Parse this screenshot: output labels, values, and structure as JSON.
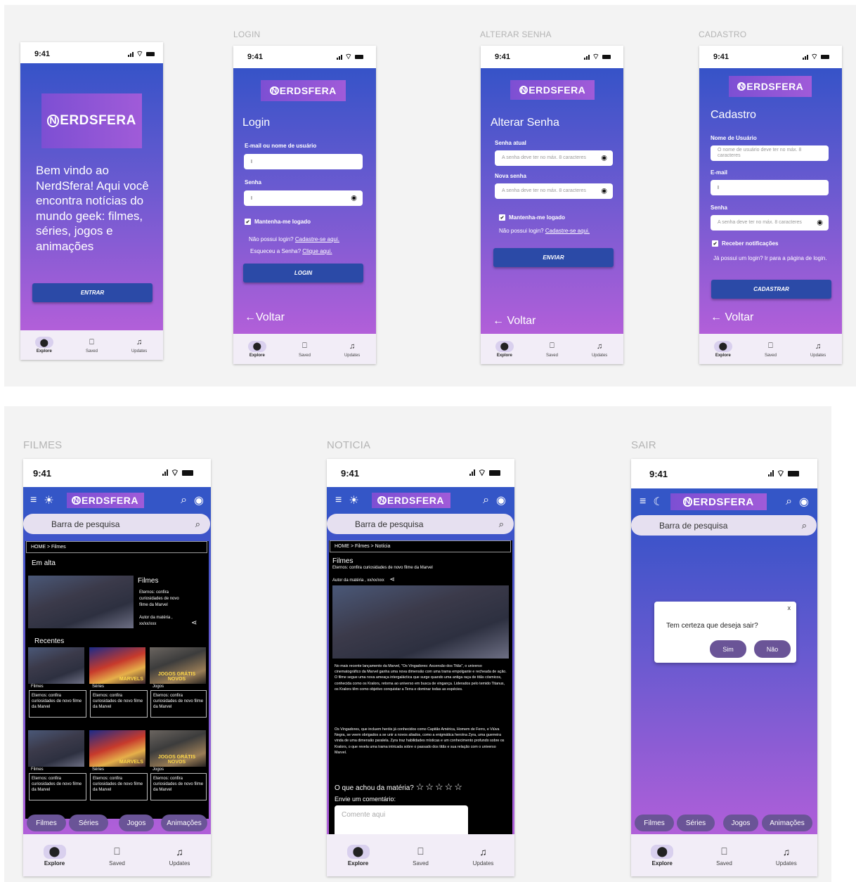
{
  "common": {
    "time": "9:41",
    "nav": {
      "explore": "Explore",
      "saved": "Saved",
      "updates": "Updates"
    },
    "logo_rest": "ERDSFERA",
    "logo_n": "N",
    "search_placeholder": "Barra de pesquisa",
    "back": "Voltar",
    "categories": [
      "Filmes",
      "Séries",
      "Jogos",
      "Animações"
    ]
  },
  "frames": {
    "login": "LOGIN",
    "alterar": "ALTERAR SENHA",
    "cadastro": "CADASTRO",
    "filmes": "FILMES",
    "noticia": "NOTICIA",
    "sair": "SAIR"
  },
  "welcome": {
    "text": "Bem vindo ao NerdSfera! Aqui você encontra notícias do mundo geek:  filmes, séries, jogos e animações",
    "button": "ENTRAR"
  },
  "login": {
    "title": "Login",
    "email_label": "E-mail  ou nome de usuário",
    "email_value": "I",
    "senha_label": "Senha",
    "senha_value": "I",
    "keep": "Mantenha-me logado",
    "no_login": "Não possui login?",
    "signup_link": "Cadastre-se aqui.",
    "forgot": "Esqueceu a Senha?",
    "forgot_link": "Clique aqui.",
    "button": "LOGIN"
  },
  "alterar": {
    "title": "Alterar Senha",
    "atual_label": "Senha atual",
    "atual_ph": "A senha deve ter no máx. 8 caracteres",
    "nova_label": "Nova senha",
    "nova_ph": "A senha deve ter no máx. 8 caracteres",
    "keep": "Mantenha-me logado",
    "no_login": "Não possui login?",
    "signup_link": "Cadastre-se aqui.",
    "button": "ENVIAR"
  },
  "cadastro": {
    "title": "Cadastro",
    "user_label": "Nome de Usuário",
    "user_ph": "O nome de usuário deve ter no máx. 8 caracteres",
    "email_label": "E-mail",
    "email_value": "I",
    "senha_label": "Senha",
    "senha_ph": "A senha deve ter no máx. 8 caracteres",
    "notif": "Receber  notificações",
    "has_login": "Já possui um login?  Ir para a página de login.",
    "button": "CADASTRAR"
  },
  "filmes": {
    "breadcrumb": "HOME  > Filmes",
    "em_alta": "Em alta",
    "featured_cat": "Filmes",
    "featured_text": "Eternos: confira curiosidades de novo filme da Marvel",
    "featured_author": "Autor da matéria , xx/xx/xxx",
    "recentes": "Recentes",
    "row1": [
      {
        "cat": "Filmes",
        "text": "Eternos: confira curiosidades de novo filme da Marvel",
        "style": ""
      },
      {
        "cat": "Séries",
        "text": "Eternos: confira curiosidades de novo filme da Marvel",
        "style": "red",
        "tt": "MARVELS"
      },
      {
        "cat": "Jogos",
        "text": "Eternos: confira curiosidades de novo filme da Marvel",
        "style": "game",
        "tt": "JOGOS GRÁTIS NOVOS"
      }
    ],
    "row2": [
      {
        "cat": "Filmes",
        "text": "Eternos: confira curiosidades de novo filme da Marvel",
        "style": ""
      },
      {
        "cat": "Séries",
        "text": "Eternos: confira curiosidades de novo filme da Marvel",
        "style": "red",
        "tt": "MARVELS"
      },
      {
        "cat": "Jogos",
        "text": "Eternos: confira curiosidades de novo filme da Marvel",
        "style": "game",
        "tt": "JOGOS GRÁTIS NOVOS"
      }
    ]
  },
  "noticia": {
    "breadcrumb": "HOME  > Filmes > Notícia",
    "cat": "Filmes",
    "headline": "Eternos: confira curiosidades de novo filme da Marvel",
    "author": "Autor da matéria , xx/xx/xxx",
    "p1": "No mais recente lançamento da Marvel, \"Os Vingadores: Ascensão dos Titãs\", o universo cinematográfico da Marvel ganha uma nova dimensão com uma trama empolgante e recheada de ação. O filme segue uma nova ameaça intergaláctica que surge quando uma antiga raça de titãs cósmicos, conhecida como os Kralors, retorna ao universo em busca de vingança. Liderados pelo temido Titanus, os Kralors têm como objetivo conquistar a Terra e dominar todas as espécies.",
    "p2": "Os Vingadores, que incluem heróis já conhecidos como Capitão América, Homem de Ferro, e Viúva Negra, se veem obrigados a se unir a novos aliados, como a enigmática heroína Zyra, uma guerreira vinda de uma dimensão paralela. Zyra traz habilidades místicas e um conhecimento profundo sobre os Kralors, o que revela uma trama intricada sobre o passado dos titãs e sua relação com o universo Marvel.",
    "rate": "O que achou da matéria?",
    "stars": "☆☆☆☆☆",
    "comment_label": "Envie um comentário:",
    "comment_ph": "Comente aqui"
  },
  "sair": {
    "question": "Tem certeza que deseja sair?",
    "yes": "Sim",
    "no": "Não",
    "close": "x"
  }
}
